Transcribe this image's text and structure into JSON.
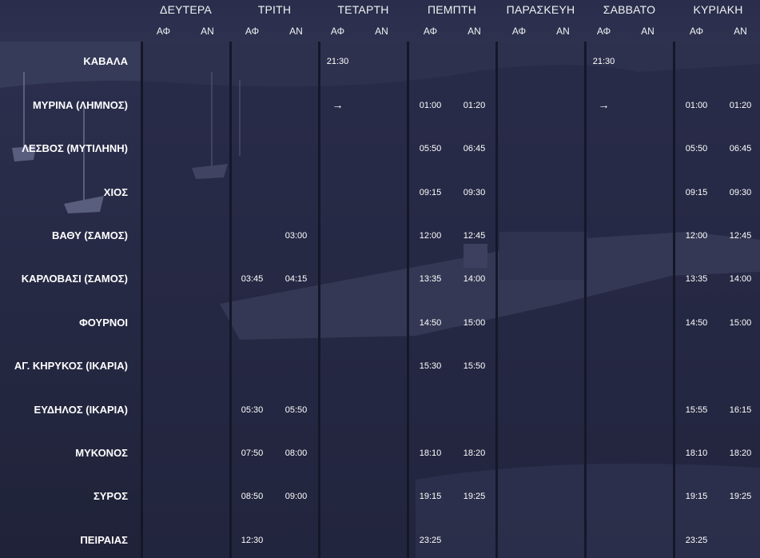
{
  "days": [
    {
      "name": "ΔΕΥΤΕΡΑ",
      "dep": "ΑΦ",
      "arr": "ΑΝ"
    },
    {
      "name": "ΤΡΙΤΗ",
      "dep": "ΑΦ",
      "arr": "ΑΝ"
    },
    {
      "name": "ΤΕΤΑΡΤΗ",
      "dep": "ΑΦ",
      "arr": "ΑΝ"
    },
    {
      "name": "ΠΕΜΠΤΗ",
      "dep": "ΑΦ",
      "arr": "ΑΝ"
    },
    {
      "name": "ΠΑΡΑΣΚΕΥΗ",
      "dep": "ΑΦ",
      "arr": "ΑΝ"
    },
    {
      "name": "ΣΑΒΒΑΤΟ",
      "dep": "ΑΦ",
      "arr": "ΑΝ"
    },
    {
      "name": "ΚΥΡΙΑΚΗ",
      "dep": "ΑΦ",
      "arr": "ΑΝ"
    }
  ],
  "rows": [
    {
      "port": "ΚΑΒΑΛΑ",
      "times": [
        [
          "",
          ""
        ],
        [
          "",
          ""
        ],
        [
          "21:30",
          ""
        ],
        [
          "",
          ""
        ],
        [
          "",
          ""
        ],
        [
          "21:30",
          ""
        ],
        [
          "",
          ""
        ]
      ]
    },
    {
      "port": "ΜΥΡΙΝΑ (ΛΗΜΝΟΣ)",
      "times": [
        [
          "",
          ""
        ],
        [
          "",
          ""
        ],
        [
          "→",
          ""
        ],
        [
          "01:00",
          "01:20"
        ],
        [
          "",
          ""
        ],
        [
          "→",
          ""
        ],
        [
          "01:00",
          "01:20"
        ]
      ]
    },
    {
      "port": "ΛΕΣΒΟΣ (ΜΥΤΙΛΗΝΗ)",
      "times": [
        [
          "",
          ""
        ],
        [
          "",
          ""
        ],
        [
          "",
          ""
        ],
        [
          "05:50",
          "06:45"
        ],
        [
          "",
          ""
        ],
        [
          "",
          ""
        ],
        [
          "05:50",
          "06:45"
        ]
      ]
    },
    {
      "port": "ΧΙΟΣ",
      "times": [
        [
          "",
          ""
        ],
        [
          "",
          ""
        ],
        [
          "",
          ""
        ],
        [
          "09:15",
          "09:30"
        ],
        [
          "",
          ""
        ],
        [
          "",
          ""
        ],
        [
          "09:15",
          "09:30"
        ]
      ]
    },
    {
      "port": "ΒΑΘΥ (ΣΑΜΟΣ)",
      "times": [
        [
          "",
          ""
        ],
        [
          "",
          "03:00"
        ],
        [
          "",
          ""
        ],
        [
          "12:00",
          "12:45"
        ],
        [
          "",
          ""
        ],
        [
          "",
          ""
        ],
        [
          "12:00",
          "12:45"
        ]
      ]
    },
    {
      "port": "ΚΑΡΛΟΒΑΣΙ (ΣΑΜΟΣ)",
      "times": [
        [
          "",
          ""
        ],
        [
          "03:45",
          "04:15"
        ],
        [
          "",
          ""
        ],
        [
          "13:35",
          "14:00"
        ],
        [
          "",
          ""
        ],
        [
          "",
          ""
        ],
        [
          "13:35",
          "14:00"
        ]
      ]
    },
    {
      "port": "ΦΟΥΡΝΟΙ",
      "times": [
        [
          "",
          ""
        ],
        [
          "",
          ""
        ],
        [
          "",
          ""
        ],
        [
          "14:50",
          "15:00"
        ],
        [
          "",
          ""
        ],
        [
          "",
          ""
        ],
        [
          "14:50",
          "15:00"
        ]
      ]
    },
    {
      "port": "ΑΓ. ΚΗΡΥΚΟΣ (ΙΚΑΡΙΑ)",
      "times": [
        [
          "",
          ""
        ],
        [
          "",
          ""
        ],
        [
          "",
          ""
        ],
        [
          "15:30",
          "15:50"
        ],
        [
          "",
          ""
        ],
        [
          "",
          ""
        ],
        [
          "",
          ""
        ]
      ]
    },
    {
      "port": "ΕΥΔΗΛΟΣ (ΙΚΑΡΙΑ)",
      "times": [
        [
          "",
          ""
        ],
        [
          "05:30",
          "05:50"
        ],
        [
          "",
          ""
        ],
        [
          "",
          ""
        ],
        [
          "",
          ""
        ],
        [
          "",
          ""
        ],
        [
          "15:55",
          "16:15"
        ]
      ]
    },
    {
      "port": "ΜΥΚΟΝΟΣ",
      "times": [
        [
          "",
          ""
        ],
        [
          "07:50",
          "08:00"
        ],
        [
          "",
          ""
        ],
        [
          "18:10",
          "18:20"
        ],
        [
          "",
          ""
        ],
        [
          "",
          ""
        ],
        [
          "18:10",
          "18:20"
        ]
      ]
    },
    {
      "port": "ΣΥΡΟΣ",
      "times": [
        [
          "",
          ""
        ],
        [
          "08:50",
          "09:00"
        ],
        [
          "",
          ""
        ],
        [
          "19:15",
          "19:25"
        ],
        [
          "",
          ""
        ],
        [
          "",
          ""
        ],
        [
          "19:15",
          "19:25"
        ]
      ]
    },
    {
      "port": "ΠΕΙΡΑΙΑΣ",
      "times": [
        [
          "",
          ""
        ],
        [
          "12:30",
          ""
        ],
        [
          "",
          ""
        ],
        [
          "23:25",
          ""
        ],
        [
          "",
          ""
        ],
        [
          "",
          ""
        ],
        [
          "23:25",
          ""
        ]
      ]
    }
  ],
  "colors": {
    "background": "#2c2f4b",
    "column_overlay": "#262844",
    "separator": "#151729",
    "text": "#ffffff"
  }
}
